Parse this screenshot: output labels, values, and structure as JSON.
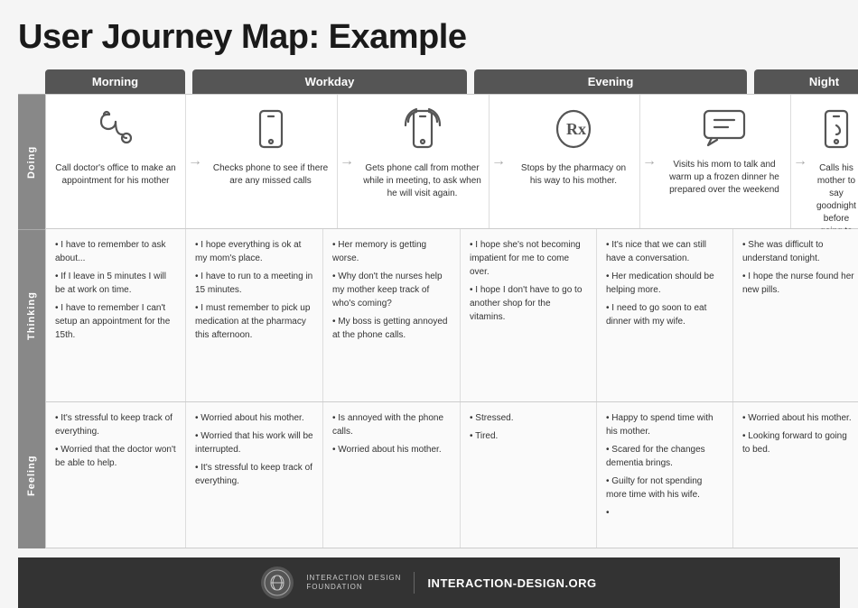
{
  "title": "User Journey Map: Example",
  "phases": {
    "morning": "Morning",
    "workday": "Workday",
    "evening": "Evening",
    "night": "Night"
  },
  "row_labels": {
    "doing": "Doing",
    "thinking": "Thinking",
    "feeling": "Feeling"
  },
  "doing": [
    {
      "icon": "stethoscope",
      "text": "Call doctor's office to make an appointment for his mother"
    },
    {
      "icon": "phone",
      "text": "Checks phone to see if there are any missed calls"
    },
    {
      "icon": "phone-ring",
      "text": "Gets phone call from mother while in meeting, to ask when he will visit again."
    },
    {
      "icon": "rx",
      "text": "Stops by the pharmacy on his way to his mother."
    },
    {
      "icon": "chat",
      "text": "Visits his mom to talk and warm up a frozen dinner he prepared over the weekend"
    },
    {
      "icon": "phone-night",
      "text": "Calls his mother to say goodnight before going to bed."
    }
  ],
  "thinking": [
    {
      "items": [
        "I have to remember to ask about...",
        "If I leave in 5 minutes I will be at work on time.",
        "I have to remember I can't setup an appointment for the 15th."
      ]
    },
    {
      "items": [
        "I hope everything is ok at my mom's place.",
        "I have to run to a meeting in 15 minutes.",
        "I must remember to pick up medication at the pharmacy this afternoon."
      ]
    },
    {
      "items": [
        "Her memory is getting worse.",
        "Why don't the nurses help my mother keep track of who's coming?",
        "My boss is getting annoyed at the phone calls."
      ]
    },
    {
      "items": [
        "I hope she's not becoming impatient for me to come over.",
        "I hope I don't have to go to another shop for the vitamins."
      ]
    },
    {
      "items": [
        "It's nice that we can still have a conversation.",
        "Her medication should be helping more.",
        "I need to go soon to eat dinner with my wife."
      ]
    },
    {
      "items": [
        "She was difficult to understand tonight.",
        "I hope the nurse found her new pills."
      ]
    }
  ],
  "feeling": [
    {
      "items": [
        "It's stressful to keep track of everything.",
        "Worried that the doctor won't be able to help."
      ]
    },
    {
      "items": [
        "Worried about his mother.",
        "Worried that his work will be interrupted.",
        "It's stressful to keep track of everything."
      ]
    },
    {
      "items": [
        "Is annoyed with the phone calls.",
        "Worried about his mother."
      ]
    },
    {
      "items": [
        "Stressed.",
        "Tired."
      ]
    },
    {
      "items": [
        "Happy to spend time with his mother.",
        "Scared for the changes dementia brings.",
        "Guilty for not spending more time with his wife."
      ]
    },
    {
      "items": [
        "Worried about his mother.",
        "Looking forward to going to bed."
      ]
    }
  ],
  "footer": {
    "org_name": "INTERACTION DESIGN\nFOUNDATION",
    "url": "INTERACTION-DESIGN.ORG"
  }
}
